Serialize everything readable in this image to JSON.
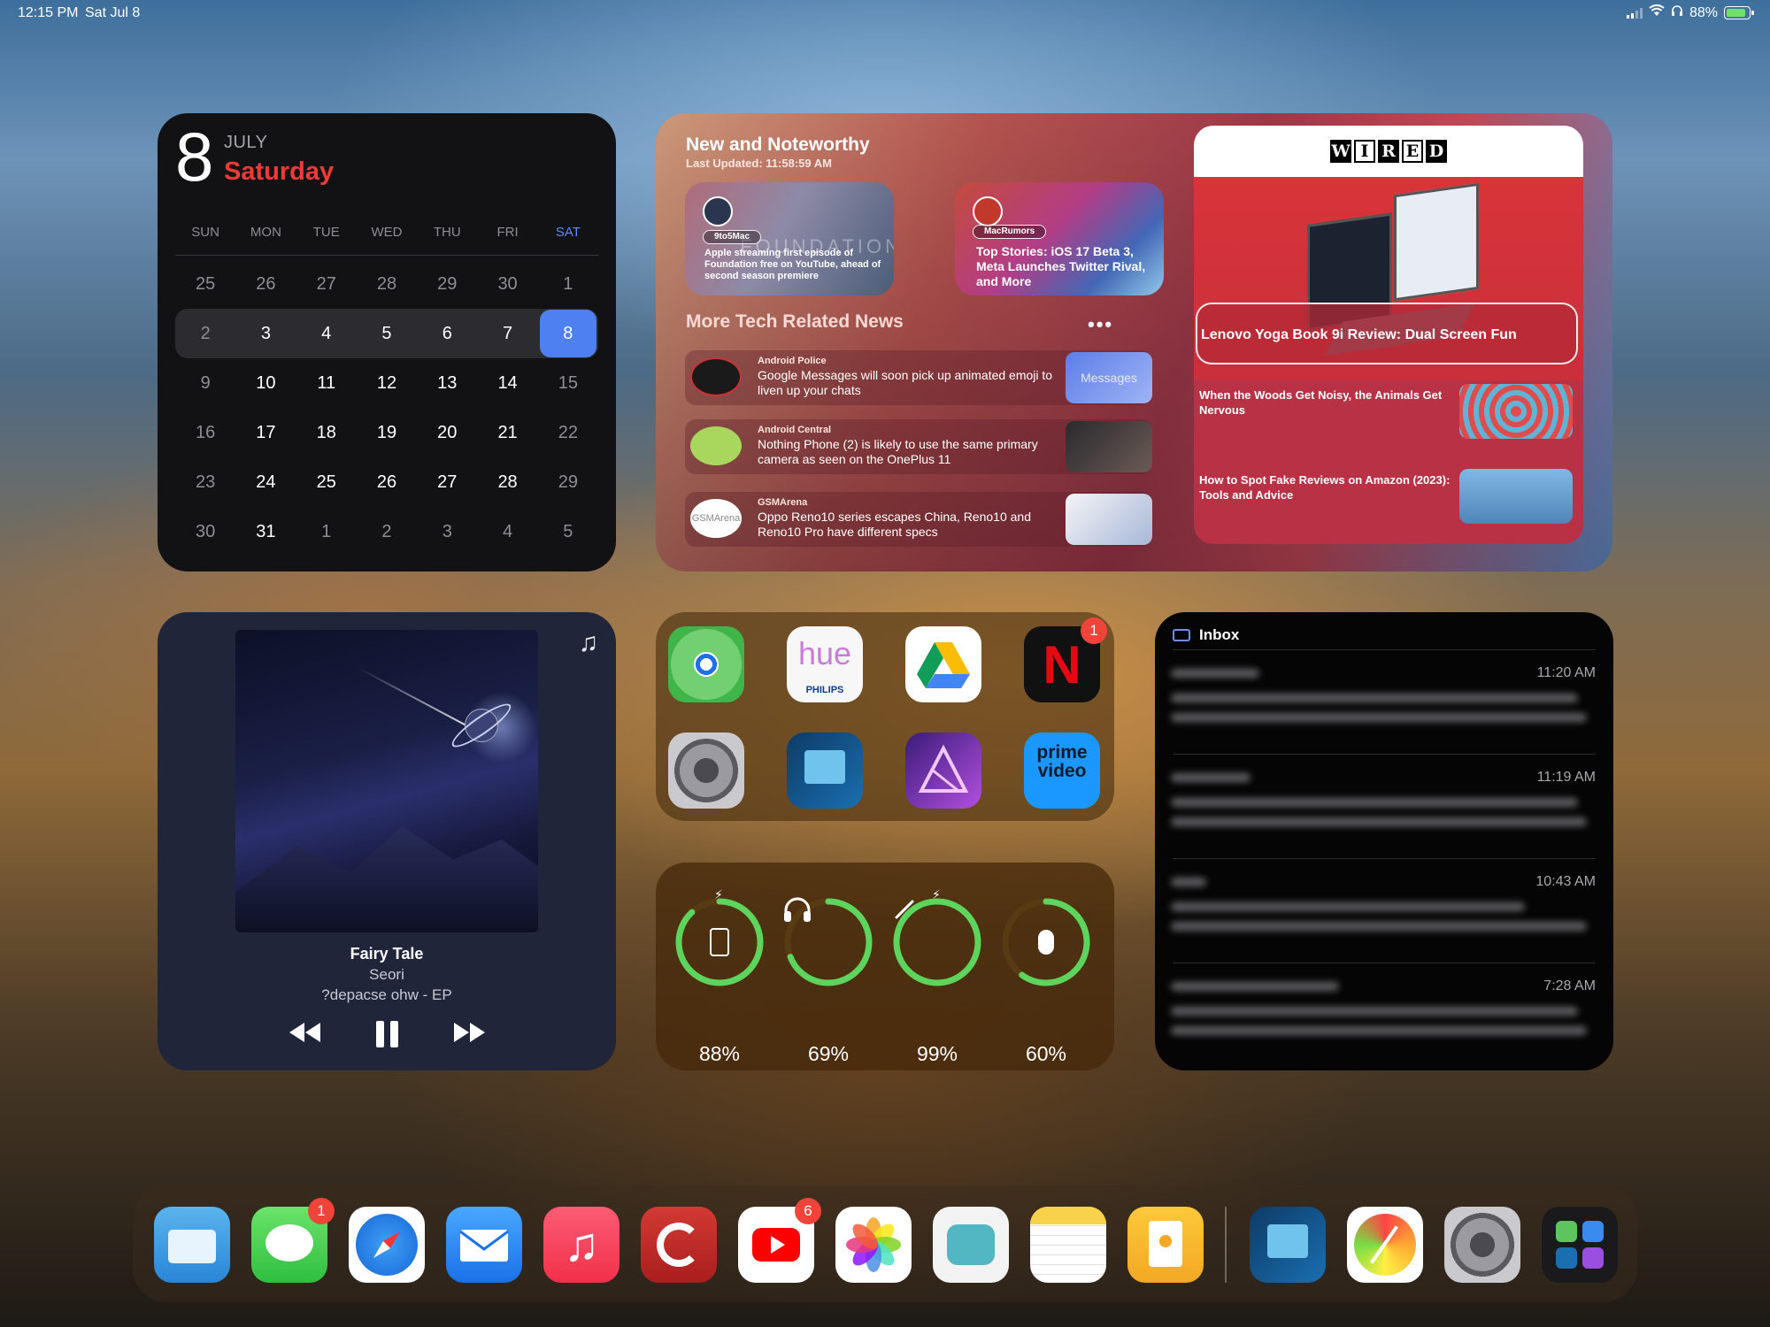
{
  "status_bar": {
    "time": "12:15 PM",
    "date": "Sat Jul 8",
    "battery": "88%",
    "battery_fraction": 0.88
  },
  "calendar": {
    "day": "8",
    "month": "JULY",
    "weekday": "Saturday",
    "headers": [
      "SUN",
      "MON",
      "TUE",
      "WED",
      "THU",
      "FRI",
      "SAT"
    ],
    "weeks": [
      [
        "25",
        "26",
        "27",
        "28",
        "29",
        "30",
        "1"
      ],
      [
        "2",
        "3",
        "4",
        "5",
        "6",
        "7",
        "8"
      ],
      [
        "9",
        "10",
        "11",
        "12",
        "13",
        "14",
        "15"
      ],
      [
        "16",
        "17",
        "18",
        "19",
        "20",
        "21",
        "22"
      ],
      [
        "23",
        "24",
        "25",
        "26",
        "27",
        "28",
        "29"
      ],
      [
        "30",
        "31",
        "1",
        "2",
        "3",
        "4",
        "5"
      ]
    ]
  },
  "news": {
    "title": "New and Noteworthy",
    "updated": "Last Updated: 11:58:59 AM",
    "stories": [
      {
        "source": "9to5Mac",
        "headline": "Apple streaming first episode of Foundation free on YouTube, ahead of second season premiere",
        "art_text": "FOUNDATION"
      },
      {
        "source": "MacRumors",
        "headline": "Top Stories: iOS 17 Beta 3, Meta Launches Twitter Rival, and More"
      }
    ],
    "more_title": "More Tech Related News",
    "more_menu": "•••",
    "items": [
      {
        "source": "Android Police",
        "headline": "Google Messages will soon pick up animated emoji to liven up your chats",
        "thumb_text": "Messages"
      },
      {
        "source": "Android Central",
        "headline": "Nothing Phone (2) is likely to use the same primary camera as seen on the OnePlus 11"
      },
      {
        "source": "GSMArena",
        "headline": "Oppo Reno10 series escapes China, Reno10 and Reno10 Pro have different specs",
        "icon_text": "GSMArena"
      }
    ],
    "wired": {
      "logo": [
        "W",
        "I",
        "R",
        "E",
        "D"
      ],
      "hero": "Lenovo Yoga Book 9i Review: Dual Screen Fun",
      "items": [
        "When the Woods Get Noisy, the Animals Get Nervous",
        "How to Spot Fake Reviews on Amazon (2023): Tools and Advice"
      ]
    }
  },
  "music": {
    "title": "Fairy Tale",
    "artist": "Seori",
    "album": "?depacse ohw - EP"
  },
  "apps_grid": [
    {
      "name": "Find My",
      "icon": "find-my-icon"
    },
    {
      "name": "Philips Hue",
      "icon": "hue-icon",
      "text": "hue",
      "subtext": "PHILIPS"
    },
    {
      "name": "Google Drive",
      "icon": "google-drive-icon"
    },
    {
      "name": "Netflix",
      "icon": "netflix-icon",
      "text": "N",
      "badge": "1"
    },
    {
      "name": "Settings",
      "icon": "settings-icon"
    },
    {
      "name": "Screens",
      "icon": "screen-app-icon"
    },
    {
      "name": "Affinity Photo",
      "icon": "affinity-photo-icon"
    },
    {
      "name": "Prime Video",
      "icon": "prime-video-icon",
      "text": "prime\nvideo"
    }
  ],
  "batteries": [
    {
      "device": "iPad",
      "icon": "ipad-icon",
      "percent": "88%",
      "level": 0.88,
      "charging": true
    },
    {
      "device": "AirPods Max",
      "icon": "headphones-icon",
      "percent": "69%",
      "level": 0.69,
      "charging": false
    },
    {
      "device": "Apple Pencil",
      "icon": "pencil-icon",
      "percent": "99%",
      "level": 0.99,
      "charging": true
    },
    {
      "device": "Magic Mouse",
      "icon": "mouse-icon",
      "percent": "60%",
      "level": 0.6,
      "charging": false
    }
  ],
  "inbox": {
    "title": "Inbox",
    "messages": [
      {
        "time": "11:20 AM"
      },
      {
        "time": "11:19 AM"
      },
      {
        "time": "10:43 AM"
      },
      {
        "time": "7:28 AM"
      }
    ]
  },
  "dock": [
    {
      "name": "Files",
      "icon": "files-icon"
    },
    {
      "name": "Messages",
      "icon": "messages-icon",
      "badge": "1"
    },
    {
      "name": "Safari",
      "icon": "safari-icon"
    },
    {
      "name": "Mail",
      "icon": "mail-icon"
    },
    {
      "name": "Music",
      "icon": "music-icon"
    },
    {
      "name": "Pocket Casts",
      "icon": "podcast-icon"
    },
    {
      "name": "YouTube",
      "icon": "youtube-icon",
      "badge": "6"
    },
    {
      "name": "Photos",
      "icon": "photos-icon"
    },
    {
      "name": "Teal App",
      "icon": "teal-app-icon"
    },
    {
      "name": "Notes",
      "icon": "notes-icon"
    },
    {
      "name": "Keynote",
      "icon": "keynote-icon"
    },
    {
      "name": "Screens",
      "icon": "screen-app-icon"
    },
    {
      "name": "Pixelmator",
      "icon": "color-wheel-icon"
    },
    {
      "name": "Settings",
      "icon": "settings-icon"
    },
    {
      "name": "App Library",
      "icon": "app-library-icon"
    }
  ],
  "colors": {
    "accent_blue": "#4f80f1",
    "calendar_red": "#f23a35",
    "battery_green": "#5dd55d",
    "badge_red": "#f0443a"
  }
}
